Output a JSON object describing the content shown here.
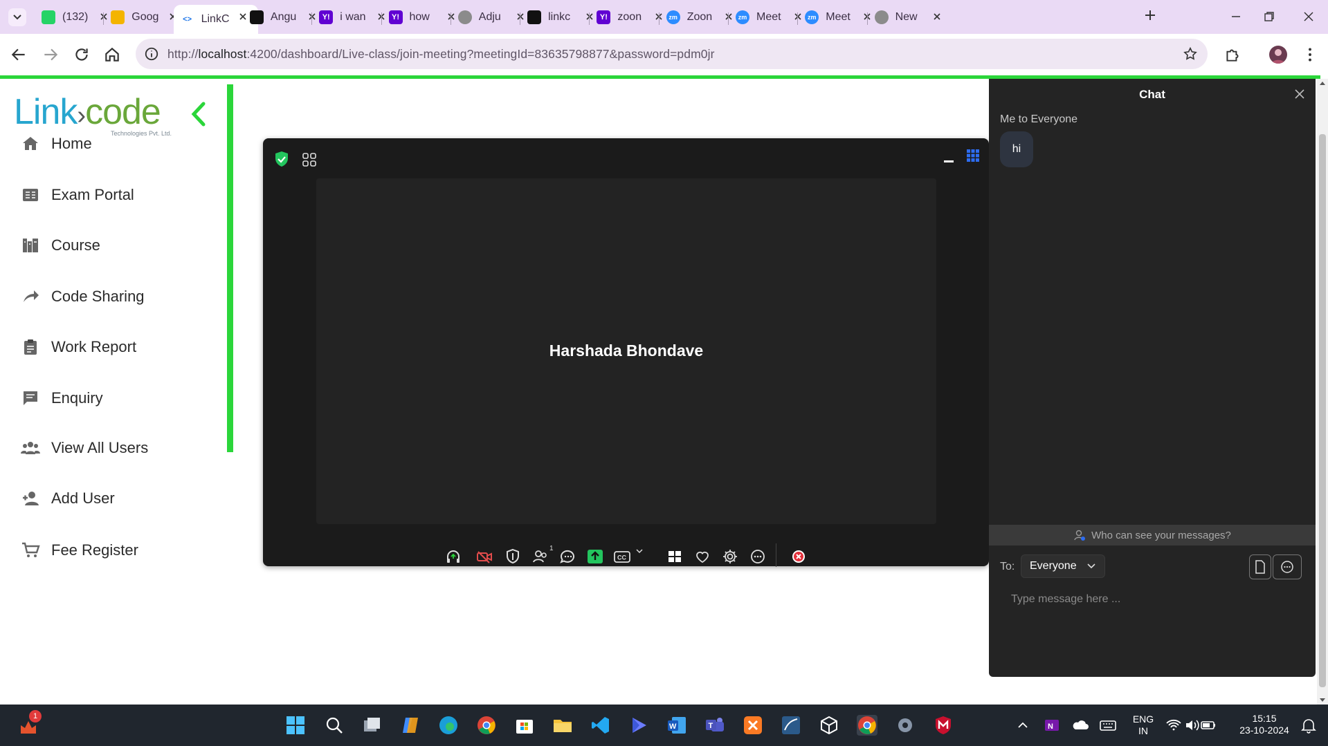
{
  "browser": {
    "tabs": [
      {
        "title": "(132)",
        "favicon": "whatsapp-icon",
        "color": "#25d366"
      },
      {
        "title": "Goog",
        "favicon": "google-classroom-icon",
        "color": "#f4b400"
      },
      {
        "title": "LinkC",
        "favicon": "linkcode-icon",
        "color": "#1a73e8",
        "active": true
      },
      {
        "title": "Angu",
        "favicon": "openai-icon",
        "color": "#111111"
      },
      {
        "title": "i wan",
        "favicon": "yahoo-icon",
        "color": "#6001d2"
      },
      {
        "title": "how",
        "favicon": "yahoo-icon",
        "color": "#6001d2"
      },
      {
        "title": "Adju",
        "favicon": "globe-icon",
        "color": "#8b8b8b"
      },
      {
        "title": "linkc",
        "favicon": "github-icon",
        "color": "#111111"
      },
      {
        "title": "zoon",
        "favicon": "yahoo-icon",
        "color": "#6001d2"
      },
      {
        "title": "Zoon",
        "favicon": "zoom-icon",
        "color": "#2d8cff"
      },
      {
        "title": "Meet",
        "favicon": "zoom-icon",
        "color": "#2d8cff"
      },
      {
        "title": "Meet",
        "favicon": "zoom-icon",
        "color": "#2d8cff"
      },
      {
        "title": "New",
        "favicon": "globe-icon",
        "color": "#8b8b8b"
      }
    ],
    "url_scheme": "http://",
    "url_host": "localhost",
    "url_rest": ":4200/dashboard/Live-class/join-meeting?meetingId=83635798877&password=pdm0jr"
  },
  "sidebar": {
    "logo_text_link": "Link",
    "logo_text_arrow": "›",
    "logo_text_code": "code",
    "logo_sub": "Technologies Pvt. Ltd.",
    "items": [
      {
        "label": "Home",
        "icon": "home-icon"
      },
      {
        "label": "Exam Portal",
        "icon": "exam-portal-icon"
      },
      {
        "label": "Course",
        "icon": "course-icon"
      },
      {
        "label": "Code Sharing",
        "icon": "share-icon"
      },
      {
        "label": "Work Report",
        "icon": "clipboard-icon"
      },
      {
        "label": "Enquiry",
        "icon": "message-icon"
      },
      {
        "label": "View All Users",
        "icon": "users-icon"
      },
      {
        "label": "Add User",
        "icon": "add-user-icon"
      },
      {
        "label": "Fee Register",
        "icon": "cart-icon"
      }
    ]
  },
  "meeting": {
    "participant_name": "Harshada Bhondave",
    "participants_count": "1"
  },
  "chat": {
    "title": "Chat",
    "from_label": "Me to Everyone",
    "messages": [
      {
        "text": "hi"
      }
    ],
    "visibility_hint": "Who can see your messages?",
    "to_label": "To:",
    "to_value": "Everyone",
    "input_placeholder": "Type message here ..."
  },
  "taskbar": {
    "notification_badge": "1",
    "lang_top": "ENG",
    "lang_bottom": "IN",
    "time": "15:15",
    "date": "23-10-2024"
  },
  "colors": {
    "accent_green": "#2bd63a",
    "brand_blue": "#27a6cf",
    "brand_green": "#6aa73a",
    "meeting_bg": "#1b1b1b"
  }
}
